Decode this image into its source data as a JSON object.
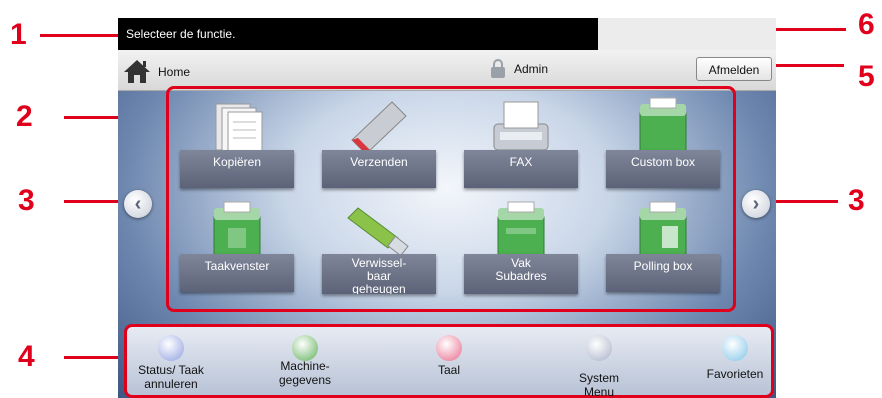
{
  "callouts": {
    "n1": "1",
    "n2": "2",
    "n3l": "3",
    "n3r": "3",
    "n4": "4",
    "n5": "5",
    "n6": "6"
  },
  "message": "Selecteer de functie.",
  "toolbar": {
    "home_label": "Home",
    "user_label": "Admin",
    "logout_label": "Afmelden"
  },
  "functions": [
    {
      "label": "Kopiëren",
      "icon": "copy-icon"
    },
    {
      "label": "Verzenden",
      "icon": "send-icon"
    },
    {
      "label": "FAX",
      "icon": "fax-icon"
    },
    {
      "label": "Custom box",
      "icon": "custom-box-icon"
    },
    {
      "label": "Taakvenster",
      "icon": "job-box-icon"
    },
    {
      "label": "Verwissel-\nbaar\ngeheugen",
      "icon": "usb-memory-icon"
    },
    {
      "label": "Vak\nSubadres",
      "icon": "subaddress-box-icon"
    },
    {
      "label": "Polling box",
      "icon": "polling-box-icon"
    }
  ],
  "bottom": [
    {
      "label": "Status/ Taak\nannuleren",
      "color": "#8f9fe0"
    },
    {
      "label": "Machine-\ngegevens",
      "color": "#5fb05a"
    },
    {
      "label": "Taal",
      "color": "#e86a8a"
    },
    {
      "label": "System\nMenu",
      "color": "#a9b0c8"
    },
    {
      "label": "Favorieten",
      "color": "#7fc4e8"
    }
  ],
  "colors": {
    "callout": "#e0001b"
  }
}
